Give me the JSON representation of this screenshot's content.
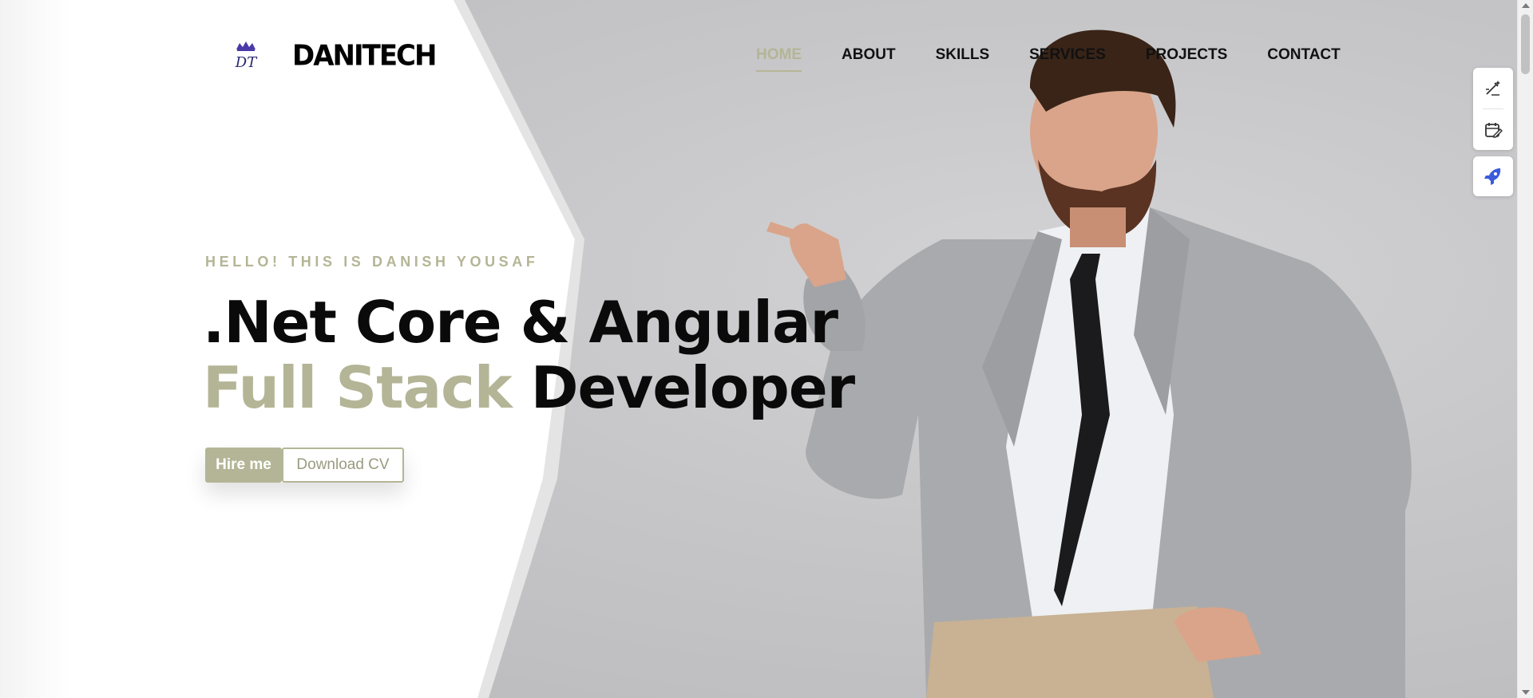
{
  "brand": {
    "logo_mark_text": "DT",
    "logo_text": "DANITECH"
  },
  "nav": {
    "items": [
      {
        "label": "HOME",
        "active": true
      },
      {
        "label": "ABOUT",
        "active": false
      },
      {
        "label": "SKILLS",
        "active": false
      },
      {
        "label": "SERVICES",
        "active": false
      },
      {
        "label": "PROJECTS",
        "active": false
      },
      {
        "label": "CONTACT",
        "active": false
      }
    ]
  },
  "hero": {
    "eyebrow": "HELLO! THIS IS DANISH YOUSAF",
    "headline_line1": ".Net Core & Angular",
    "headline_line2_accent": "Full Stack",
    "headline_line2_rest": "Developer",
    "primary_button": "Hire me",
    "secondary_button": "Download CV"
  },
  "side_tools": [
    {
      "icon": "edit-wand-icon"
    },
    {
      "icon": "calendar-edit-icon"
    },
    {
      "icon": "rocket-icon"
    }
  ],
  "colors": {
    "accent": "#b4b596",
    "text": "#0a0a0a",
    "logo_purple": "#4a3aa8",
    "rocket_blue": "#3b5bdb"
  }
}
